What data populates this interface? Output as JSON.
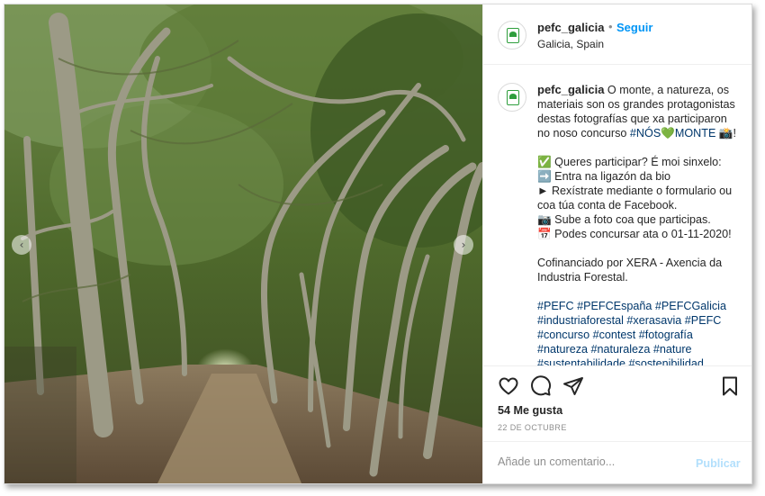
{
  "header": {
    "username": "pefc_galicia",
    "separator": "•",
    "follow_label": "Seguir",
    "location": "Galicia, Spain"
  },
  "caption": {
    "username": "pefc_galicia",
    "intro_1": " O monte, a natureza, os",
    "intro_2": "materiais son os grandes protagonistas",
    "intro_3": "destas fotografías que xa participaron",
    "intro_4a": "no noso concurso ",
    "intro_tag": "#NÓS💚MONTE",
    "intro_4b": " 📸!",
    "list_1": "✅ Queres participar? É moi sinxelo:",
    "list_2": "➡️ Entra na ligazón da bio",
    "list_3": "► Rexístrate mediante o formulario ou",
    "list_4": "coa túa conta de Facebook.",
    "list_5": "📷 Sube a foto coa que participas.",
    "list_6": "📅 Podes concursar ata o 01-11-2020!",
    "funding_1": "Cofinanciado por XERA - Axencia da",
    "funding_2": "Industria Forestal.",
    "hashtags_1": "#PEFC #PEFCEspaña #PEFCGalicia",
    "hashtags_2": "#industriaforestal #xerasavia #PEFC",
    "hashtags_3": "#concurso #contest #fotografía",
    "hashtags_4": "#natureza #naturaleza #nature",
    "hashtags_5": "#sustentabilidade #sostenibilidad"
  },
  "actions": {
    "icons": [
      "heart-icon",
      "comment-icon",
      "share-icon",
      "bookmark-icon"
    ],
    "likes": "54 Me gusta",
    "date": "22 DE OCTUBRE"
  },
  "comment": {
    "placeholder": "Añade un comentario...",
    "publish_label": "Publicar"
  },
  "carousel": {
    "prev_icon": "chevron-left-icon",
    "next_icon": "chevron-right-icon",
    "prev_glyph": "‹",
    "next_glyph": "›"
  },
  "colors": {
    "link_blue": "#0095f6",
    "hashtag": "#00376b",
    "brand_green": "#2e9e3c",
    "publish_disabled": "#b2dffc"
  }
}
